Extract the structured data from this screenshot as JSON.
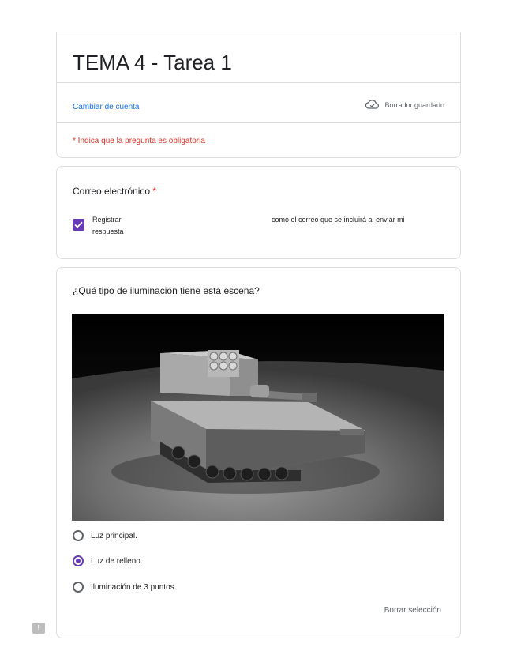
{
  "form": {
    "title": "TEMA 4 - Tarea 1",
    "switch_account": "Cambiar de cuenta",
    "draft_status": "Borrador guardado",
    "required_note": "* Indica que la pregunta es obligatoria"
  },
  "email_question": {
    "title": "Correo electrónico",
    "required_marker": "*",
    "checkbox_checked": true,
    "checkbox_label_start": "Registrar respuesta",
    "checkbox_label_end": "como el correo que se incluirá al enviar mi"
  },
  "question": {
    "title": "¿Qué tipo de iluminación tiene esta escena?",
    "image_icon": "tank-render-image",
    "options": [
      {
        "label": "Luz principal.",
        "selected": false
      },
      {
        "label": "Luz de relleno.",
        "selected": true
      },
      {
        "label": "Iluminación de 3 puntos.",
        "selected": false
      }
    ],
    "clear_label": "Borrar selección"
  },
  "icons": {
    "draft": "cloud-check-icon",
    "report": "report-icon"
  },
  "colors": {
    "accent": "#673ab7",
    "link": "#1a73e8",
    "required": "#d93025"
  }
}
